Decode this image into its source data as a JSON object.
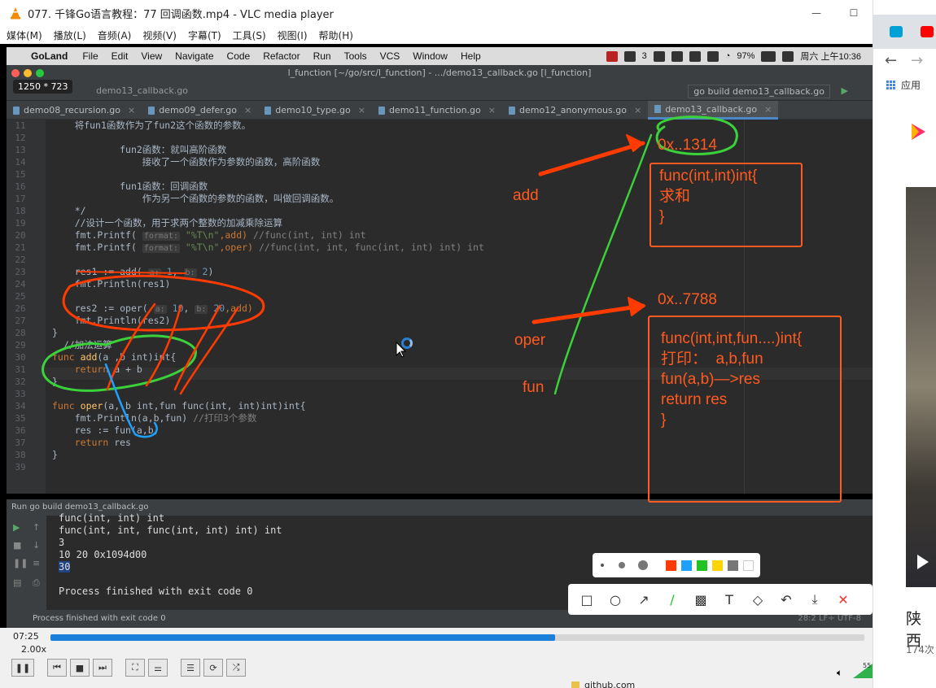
{
  "vlc": {
    "title": "077. 千锋Go语言教程：77 回调函数.mp4 - VLC media player",
    "menu": [
      "媒体(M)",
      "播放(L)",
      "音频(A)",
      "视频(V)",
      "字幕(T)",
      "工具(S)",
      "视图(I)",
      "帮助(H)"
    ],
    "time_elapsed": "07:25",
    "speed": "2.00x",
    "progress": 0.62,
    "volume_label": "55"
  },
  "mac": {
    "menu": [
      "GoLand",
      "File",
      "Edit",
      "View",
      "Navigate",
      "Code",
      "Refactor",
      "Run",
      "Tools",
      "VCS",
      "Window",
      "Help"
    ],
    "battery": "97%",
    "wechat_count": "3",
    "clock": "周六 上午10:36"
  },
  "ide": {
    "window_title": "l_function [~/go/src/l_function] - .../demo13_callback.go [l_function]",
    "dimension_badge": "1250 * 723",
    "breadcrumb": "demo13_callback.go",
    "run_config": "go build demo13_callback.go",
    "tabs": [
      "demo08_recursion.go",
      "demo09_defer.go",
      "demo10_type.go",
      "demo11_function.go",
      "demo12_anonymous.go",
      "demo13_callback.go"
    ],
    "active_tab": 5,
    "line_numbers": [
      "11",
      "12",
      "13",
      "14",
      "15",
      "16",
      "17",
      "18",
      "19",
      "20",
      "21",
      "22",
      "23",
      "24",
      "25",
      "26",
      "27",
      "28",
      "29",
      "30",
      "31",
      "32",
      "33",
      "34",
      "35",
      "36",
      "37",
      "38",
      "39"
    ],
    "run_header": "go build demo13_callback.go",
    "run_label": "Run",
    "output": [
      "func(int, int) int",
      "func(int, int, func(int, int) int) int",
      "3",
      "10 20 0x1094d00",
      "30",
      "",
      "Process finished with exit code 0"
    ],
    "status": "Process finished with exit code 0",
    "status_right": "28:2  LF÷  UTF-8"
  },
  "code": {
    "l11": "将fun1函数作为了fun2这个函数的参数。",
    "l13": "fun2函数：就叫高阶函数",
    "l14": "接收了一个函数作为参数的函数，高阶函数",
    "l16": "fun1函数：回调函数",
    "l17": "作为另一个函数的参数的函数，叫做回调函数。",
    "l18": "*/",
    "l19": "//设计一个函数，用于求两个整数的加减乘除运算",
    "l20_a": "fmt.Printf(",
    "l20_hint": "format:",
    "l20_str": "\"%T\\n\"",
    "l20_b": ",add)",
    "l20_cm": "//func(int, int) int",
    "l21_a": "fmt.Printf(",
    "l21_hint": "format:",
    "l21_str": "\"%T\\n\"",
    "l21_b": ",oper)",
    "l21_cm": "//func(int, int, func(int, int) int) int",
    "l23_a": "res1 := add(",
    "l23_h1": "a:",
    "l23_v1": "1",
    "l23_h2": "b:",
    "l23_v2": "2",
    "l23_b": ")",
    "l24": "fmt.Println(res1)",
    "l26_a": "res2 := oper(",
    "l26_h1": "a:",
    "l26_v1": "10",
    "l26_h2": "b:",
    "l26_v2": "20",
    "l26_b": ",add)",
    "l27": "fmt.Println(res2)",
    "l28": "}",
    "l29": "//加法运算",
    "l30_kw": "func",
    "l30_fn": "add",
    "l30_rest": "(a ,b int)int{",
    "l31_kw": "return",
    "l31_rest": "a + b",
    "l32": "}",
    "l34_kw": "func",
    "l34_fn": "oper",
    "l34_rest": "(a, b int,fun func(int, int)int)int{",
    "l35_a": "fmt.Println(a,b,fun)",
    "l35_cm": "//打印3个参数",
    "l36": "res := fun(a,b)",
    "l37_kw": "return",
    "l37_rest": "res",
    "l38": "}"
  },
  "annotations": {
    "addr1": "0x..1314",
    "box1": "func(int,int)int{\n求和\n}",
    "label_add": "add",
    "addr2": "0x..7788",
    "box2": "func(int,int,fun....)int{\n打印：  a,b,fun\nfun(a,b)—>res\nreturn res\n}",
    "label_oper": "oper",
    "label_fun": "fun"
  },
  "palette_colors": [
    "#ff3b00",
    "#1ea0ff",
    "#22c222",
    "#ffd400",
    "#777777",
    "#ffffff"
  ],
  "browser": {
    "apps_label": "应用",
    "video_title": "陕西",
    "video_sub": "174次"
  },
  "taskbar": {
    "item": "github.com"
  }
}
